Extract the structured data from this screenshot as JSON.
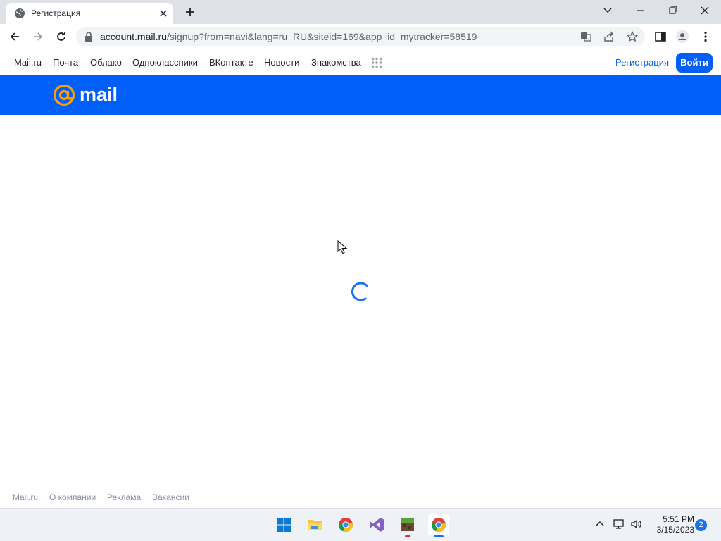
{
  "browser": {
    "tab_title": "Регистрация",
    "url_host": "account.mail.ru",
    "url_rest": "/signup?from=navi&lang=ru_RU&siteid=169&app_id_mytracker=58519"
  },
  "portal_nav": {
    "items": [
      "Mail.ru",
      "Почта",
      "Облако",
      "Одноклассники",
      "ВКонтакте",
      "Новости",
      "Знакомства"
    ],
    "register_label": "Регистрация",
    "login_label": "Войти"
  },
  "header": {
    "logo_text": "mail",
    "brand_color": "#005ff9",
    "logo_accent": "#ff9e00"
  },
  "main": {
    "state": "loading"
  },
  "footer": {
    "items": [
      "Mail.ru",
      "О компании",
      "Реклама",
      "Вакансии"
    ]
  },
  "taskbar": {
    "apps": [
      "start-icon",
      "file-explorer-icon",
      "chrome-icon",
      "visual-studio-icon",
      "minecraft-icon",
      "chrome-icon"
    ],
    "time": "5:51 PM",
    "date": "3/15/2023",
    "notification_count": "2"
  }
}
